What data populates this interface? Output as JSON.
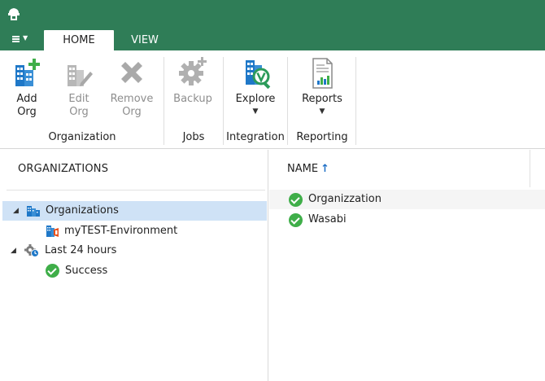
{
  "colors": {
    "brand_green": "#2f7d57",
    "accent_blue": "#1f78c8",
    "success_green": "#3fae49",
    "selection": "#cfe2f6"
  },
  "menu": {
    "icon": "hamburger-icon"
  },
  "tabs": [
    {
      "label": "HOME",
      "active": true
    },
    {
      "label": "VIEW",
      "active": false
    }
  ],
  "ribbon": {
    "add_org": {
      "label": "Add\nOrg",
      "icon": "add-org-icon",
      "enabled": true
    },
    "edit_org": {
      "label": "Edit\nOrg",
      "icon": "edit-org-icon",
      "enabled": false
    },
    "remove_org": {
      "label": "Remove\nOrg",
      "icon": "remove-icon",
      "enabled": false
    },
    "backup": {
      "label": "Backup",
      "icon": "backup-gear-icon",
      "enabled": false
    },
    "explore": {
      "label": "Explore",
      "icon": "explore-icon",
      "enabled": true,
      "dropdown": true
    },
    "reports": {
      "label": "Reports",
      "icon": "reports-icon",
      "enabled": true,
      "dropdown": true
    },
    "groups": {
      "organization": "Organization",
      "jobs": "Jobs",
      "integration": "Integration",
      "reporting": "Reporting"
    }
  },
  "left_pane": {
    "title": "ORGANIZATIONS",
    "tree": [
      {
        "label": "Organizations",
        "icon": "organizations-icon",
        "expanded": true,
        "selected": true
      },
      {
        "label": "myTEST-Environment",
        "icon": "office365-org-icon"
      },
      {
        "label": "Last 24 hours",
        "icon": "jobs-history-icon",
        "expanded": true
      },
      {
        "label": "Success",
        "icon": "success-icon"
      }
    ]
  },
  "right_pane": {
    "column": "NAME",
    "sort_icon": "sort-ascending-icon",
    "rows": [
      {
        "name": "Organizzation",
        "status_icon": "success-icon"
      },
      {
        "name": "Wasabi",
        "status_icon": "success-icon"
      }
    ]
  }
}
